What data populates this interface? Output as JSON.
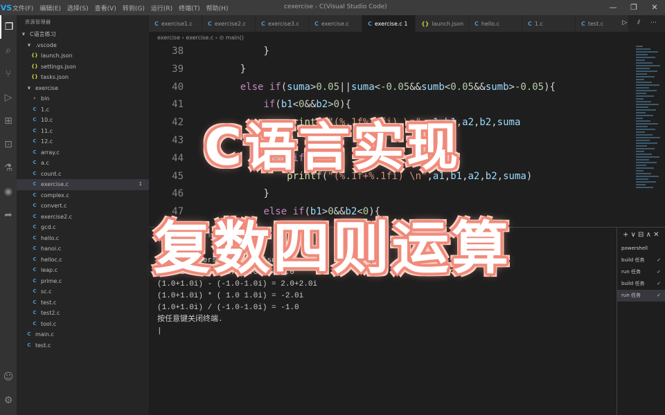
{
  "titlebar": {
    "logo": "VS",
    "menu": [
      "文件(F)",
      "编辑(E)",
      "选择(S)",
      "查看(V)",
      "转到(G)",
      "运行(R)",
      "终端(T)",
      "帮助(H)"
    ],
    "window_title": "cexercise - C(Visual Studio Code)",
    "win_controls": [
      "—",
      "❐",
      "✕"
    ]
  },
  "activity": {
    "icons": [
      "files-icon",
      "search-icon",
      "source-control-icon",
      "run-debug-icon",
      "extensions-icon",
      "remote-icon",
      "test-icon",
      "github-icon",
      "share-icon"
    ],
    "glyphs": [
      "❐",
      "⌕",
      "⑂",
      "▷",
      "⊞",
      "⊡",
      "⚗",
      "◉",
      "➦"
    ],
    "bottom_glyphs": [
      "☺",
      "⚙"
    ]
  },
  "explorer": {
    "header": "资源管理器",
    "rows": [
      {
        "icon": "∨",
        "label": "C语言练习",
        "indent": 4
      },
      {
        "icon": "∨",
        "label": ".vscode",
        "indent": 12
      },
      {
        "icon": "{}",
        "label": "launch.json",
        "indent": 20,
        "json": true
      },
      {
        "icon": "{}",
        "label": "settings.json",
        "indent": 20,
        "json": true
      },
      {
        "icon": "{}",
        "label": "tasks.json",
        "indent": 20,
        "json": true
      },
      {
        "icon": "∨",
        "label": "exercise",
        "indent": 12
      },
      {
        "icon": "›",
        "label": "bin",
        "indent": 20
      },
      {
        "icon": "C",
        "label": "1.c",
        "indent": 20
      },
      {
        "icon": "C",
        "label": "10.c",
        "indent": 20
      },
      {
        "icon": "C",
        "label": "11.c",
        "indent": 20
      },
      {
        "icon": "C",
        "label": "12.c",
        "indent": 20
      },
      {
        "icon": "C",
        "label": "array.c",
        "indent": 20
      },
      {
        "icon": "C",
        "label": "a.c",
        "indent": 20
      },
      {
        "icon": "C",
        "label": "count.c",
        "indent": 20
      },
      {
        "icon": "C",
        "label": "exercise.c",
        "indent": 20,
        "selected": true,
        "badge": "1"
      },
      {
        "icon": "C",
        "label": "complex.c",
        "indent": 20
      },
      {
        "icon": "C",
        "label": "convert.c",
        "indent": 20
      },
      {
        "icon": "C",
        "label": "exercise2.c",
        "indent": 20
      },
      {
        "icon": "C",
        "label": "gcd.c",
        "indent": 20
      },
      {
        "icon": "C",
        "label": "hello.c",
        "indent": 20
      },
      {
        "icon": "C",
        "label": "hanoi.c",
        "indent": 20
      },
      {
        "icon": "C",
        "label": "helloc.c",
        "indent": 20
      },
      {
        "icon": "C",
        "label": "leap.c",
        "indent": 20
      },
      {
        "icon": "C",
        "label": "prime.c",
        "indent": 20
      },
      {
        "icon": "C",
        "label": "sc.c",
        "indent": 20
      },
      {
        "icon": "C",
        "label": "test.c",
        "indent": 20
      },
      {
        "icon": "C",
        "label": "test2.c",
        "indent": 20
      },
      {
        "icon": "C",
        "label": "tool.c",
        "indent": 20
      },
      {
        "icon": "C",
        "label": "main.c",
        "indent": 12
      },
      {
        "icon": "C",
        "label": "test.c",
        "indent": 12
      }
    ]
  },
  "tabs": [
    {
      "label": "exercise1.c",
      "json": false,
      "active": false
    },
    {
      "label": "exercise2.c",
      "json": false,
      "active": false
    },
    {
      "label": "exercise3.c",
      "json": false,
      "active": false
    },
    {
      "label": "exercise.c",
      "json": false,
      "active": false
    },
    {
      "label": "exercise.c 1",
      "json": false,
      "active": true
    },
    {
      "label": "launch.json",
      "json": true,
      "active": false
    },
    {
      "label": "hello.c",
      "json": false,
      "active": false
    },
    {
      "label": "1.c",
      "json": false,
      "active": false
    },
    {
      "label": "test.c",
      "json": false,
      "active": false
    }
  ],
  "tab_actions": "▷ ⫽ ⋯",
  "breadcrumb": "exercise › exercise.c › ⊙ main()",
  "editor": {
    "lines": [
      {
        "n": "38",
        "html": "        }"
      },
      {
        "n": "39",
        "html": "    }"
      },
      {
        "n": "40",
        "html": "    <span class='k'>else</span> <span class='k'>if</span>(<span class='v'>suma</span>&gt;<span class='n'>0.05</span>||<span class='v'>suma</span>&lt;<span class='n'>-0.05</span>&amp;&amp;<span class='v'>sumb</span>&lt;<span class='n'>0.05</span>&amp;&amp;<span class='v'>sumb</span>&gt;<span class='n'>-0.05</span>){"
      },
      {
        "n": "41",
        "html": "        <span class='k'>if</span>(<span class='v'>b1</span>&lt;<span class='n'>0</span>&amp;&amp;<span class='v'>b2</span>&gt;<span class='n'>0</span>){"
      },
      {
        "n": "42",
        "html": "            <span class='fn'>printf</span>(<span class='s'>\"(%.1f%.1fi) \\n\"</span>,<span class='v'>a1</span>,<span class='v'>b1</span>,<span class='v'>a2</span>,<span class='v'>b2</span>,<span class='v'>suma</span>"
      },
      {
        "n": "43",
        "html": "        }"
      },
      {
        "n": "44",
        "html": "        <span class='k'>else</span> <span class='k'>if</span>(<span class='v'>b1</span>&gt;<span class='n'>0</span>){"
      },
      {
        "n": "45",
        "html": "            <span class='fn'>printf</span>(<span class='s'>\"(%.1f+%.1fi) \\n\"</span>,<span class='v'>a1</span>,<span class='v'>b1</span>,<span class='v'>a2</span>,<span class='v'>b2</span>,<span class='v'>suma</span>)"
      },
      {
        "n": "46",
        "html": "        }"
      },
      {
        "n": "47",
        "html": "        <span class='k'>else</span> <span class='k'>if</span>(<span class='v'>b1</span>&gt;<span class='n'>0</span>&amp;&amp;<span class='v'>b2</span>&lt;<span class='n'>0</span>){"
      }
    ]
  },
  "panel": {
    "tabs_text": "问题  输出  调试控制台  终端",
    "terminal_lines": [
      "",
      "> & 'c:\\Users\\...\\exercise.exe' <",
      "",
      "(1.0+1.0i) + (-1.0-1.0i) = 0.0",
      "(1.0+1.0i) - (-1.0-1.0i) = 2.0+2.0i",
      "(1.0+1.0i) * ( 1.0 1.0i) = -2.0i",
      "(1.0+1.0i) / (-1.0-1.0i) = -1.0",
      "按任意键关闭终端.",
      "|"
    ],
    "term_actions": "+ ∨  ⊟ ∧ ✕",
    "terminals": [
      {
        "label": "powershell",
        "check": ""
      },
      {
        "label": "build 任务",
        "check": "✓"
      },
      {
        "label": "run 任务",
        "check": "✓"
      },
      {
        "label": "build 任务",
        "check": "✓"
      },
      {
        "label": "run 任务",
        "check": "✓"
      }
    ]
  },
  "overlay": {
    "line1": "C语言实现",
    "line2": "复数四则运算"
  }
}
